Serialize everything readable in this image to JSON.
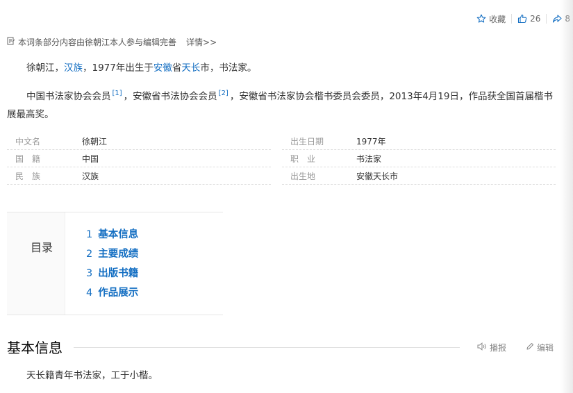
{
  "topbar": {
    "favorite": "收藏",
    "likes": "26",
    "shares": "8"
  },
  "notice": {
    "text": "本词条部分内容由徐朝江本人参与编辑完善",
    "detail": "详情>>"
  },
  "intro": {
    "p1": {
      "name": "徐朝江，",
      "ethnic": "汉族",
      "mid1": "，1977年出生于",
      "province": "安徽",
      "mid2": "省",
      "city": "天长",
      "tail": "市，书法家。"
    },
    "p2": {
      "a": "中国书法家协会会员",
      "ref1": "[1]",
      "b": "，安徽省书法协会会员",
      "ref2": "[2]",
      "c": "，安徽省书法家协会楷书委员会委员，2013年4月19日，作品获全国首届楷书展最高奖。"
    }
  },
  "infobox": {
    "left": [
      {
        "label": "中文名",
        "value": "徐朝江"
      },
      {
        "label": "国　籍",
        "value": "中国"
      },
      {
        "label": "民　族",
        "value": "汉族"
      }
    ],
    "right": [
      {
        "label": "出生日期",
        "value": "1977年"
      },
      {
        "label": "职　业",
        "value": "书法家"
      },
      {
        "label": "出生地",
        "value": "安徽天长市"
      }
    ]
  },
  "toc": {
    "title": "目录",
    "items": [
      {
        "num": "1",
        "label": "基本信息"
      },
      {
        "num": "2",
        "label": "主要成绩"
      },
      {
        "num": "3",
        "label": "出版书籍"
      },
      {
        "num": "4",
        "label": "作品展示"
      }
    ]
  },
  "section": {
    "title": "基本信息",
    "read": "播报",
    "edit": "编辑",
    "body": "天长籍青年书法家，工于小楷。"
  }
}
